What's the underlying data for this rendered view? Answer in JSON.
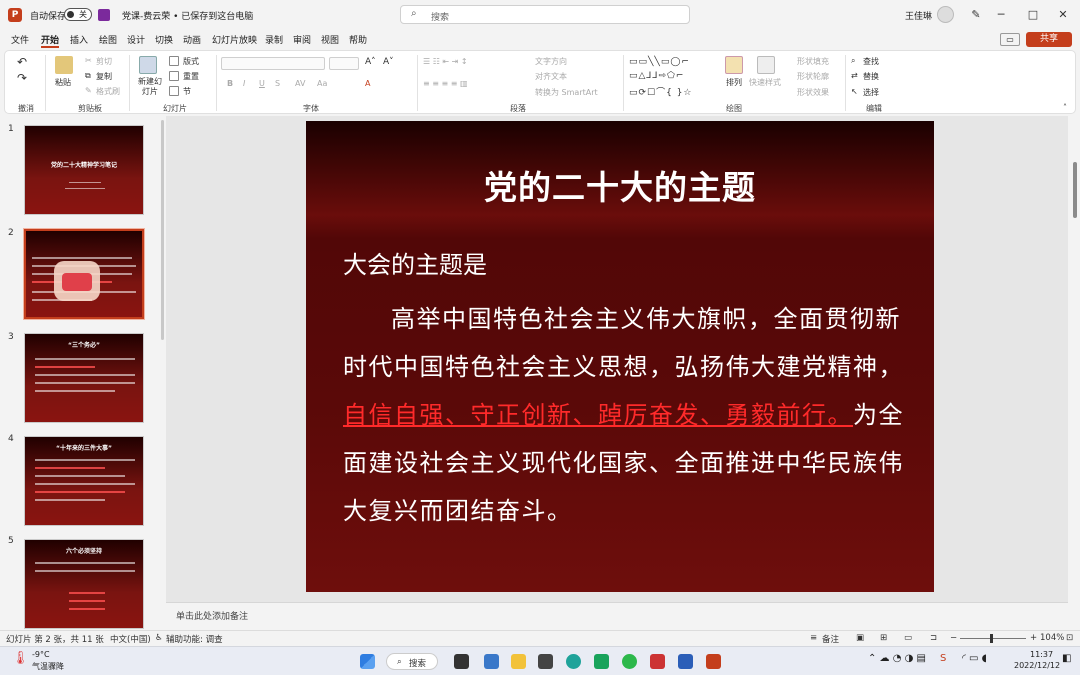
{
  "titlebar": {
    "autosave_label": "自动保存",
    "autosave_state": "关",
    "doc_title": "党课-费云荣 • 已保存到这台电脑",
    "search_placeholder": "搜索",
    "user_name": "王佳琳"
  },
  "menu": {
    "tabs": [
      "文件",
      "开始",
      "插入",
      "绘图",
      "设计",
      "切换",
      "动画",
      "幻灯片放映",
      "录制",
      "审阅",
      "视图",
      "帮助"
    ],
    "active": "开始",
    "share_label": "共享"
  },
  "ribbon": {
    "groups": [
      "撤消",
      "剪贴板",
      "幻灯片",
      "字体",
      "段落",
      "绘图",
      "编辑"
    ],
    "clipboard": {
      "paste": "粘贴",
      "cut": "剪切",
      "copy": "复制",
      "format_painter": "格式刷"
    },
    "slides": {
      "new_slide": "新建幻灯片",
      "layout": "版式",
      "reset": "重置",
      "section": "节"
    },
    "paragraph": {
      "text_direction": "文字方向",
      "align_text": "对齐文本",
      "smartart": "转换为 SmartArt"
    },
    "drawing": {
      "arrange": "排列",
      "quick_styles": "快速样式",
      "shape_fill": "形状填充",
      "shape_outline": "形状轮廓",
      "shape_effects": "形状效果"
    },
    "editing": {
      "find": "查找",
      "replace": "替换",
      "select": "选择"
    }
  },
  "thumbnails": [
    {
      "num": "1",
      "title": "党的二十大精神学习笔记"
    },
    {
      "num": "2",
      "title": ""
    },
    {
      "num": "3",
      "title": "“三个务必”"
    },
    {
      "num": "4",
      "title": "“十年来的三件大事”"
    },
    {
      "num": "5",
      "title": "六个必须坚持"
    }
  ],
  "slide": {
    "title": "党的二十大的主题",
    "intro": "大会的主题是",
    "body_part1": "高举中国特色社会主义伟大旗帜，全面贯彻新时代中国特色社会主义思想，弘扬伟大建党精神，",
    "body_highlight": "自信自强、守正创新、踔厉奋发、勇毅前行。",
    "body_part2": "为全面建设社会主义现代化国家、全面推进中华民族伟大复兴而团结奋斗。",
    "highlight_color": "#ff2a2a"
  },
  "notes_placeholder": "单击此处添加备注",
  "status": {
    "slide_count": "幻灯片 第 2 张，共 11 张",
    "language": "中文(中国)",
    "accessibility": "辅助功能: 调查",
    "notes_label": "备注",
    "zoom": "104%"
  },
  "taskbar": {
    "weather_temp": "-9°C",
    "weather_desc": "气温骤降",
    "search_label": "搜索",
    "time": "11:37",
    "date": "2022/12/12"
  },
  "colors": {
    "accent": "#c43e1c",
    "slide_bg": "#5a0908"
  }
}
